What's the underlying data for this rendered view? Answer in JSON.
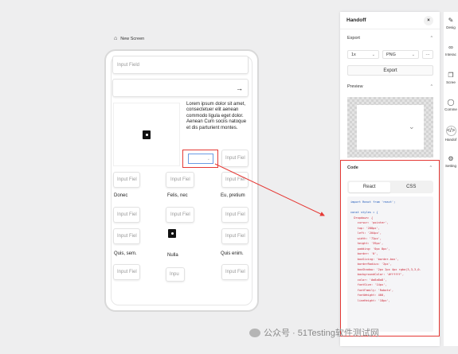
{
  "canvas": {
    "screen_title": "New Screen",
    "input_field_placeholder": "Input Field",
    "arrow_glyph": "→",
    "lorem_text": "Lorem ipsum dolor sit amet, consectetuer elit aenean commodo ligula eget dolor. Aenean Cum sociis natoque et dis parturient montes.",
    "dropdown_chevron": "⌄",
    "input_short": "Input Fiel",
    "labels": {
      "donec": "Donec",
      "felis": "Felis, nec",
      "eu": "Eu, pretium",
      "quis_sem": "Quis, sem.",
      "nulla": "Nulla",
      "quis_enim": "Quis enim.",
      "inpu": "Inpu"
    }
  },
  "panel": {
    "title": "Handoff",
    "close": "×",
    "export_label": "Export",
    "scale_value": "1x",
    "format_value": "PNG",
    "more": "···",
    "export_button": "Export",
    "preview_label": "Preview",
    "code_label": "Code",
    "tabs": [
      "React",
      "CSS"
    ],
    "code_lines": [
      "import React from 'react';",
      "",
      "const styles = {",
      "  Dropdown: {",
      "    cursor: 'pointer',",
      "    top: '288px',",
      "    left: '204px',",
      "    width: '72px',",
      "    height: '39px',",
      "    padding: '0px 8px',",
      "    border: '0',",
      "    boxSizing: 'border-box',",
      "    borderRadius: '2px',",
      "    boxShadow: '2px 2px 4px rgba(3,3,3,0.",
      "    backgroundColor: '#ffffff',",
      "    color: '#a8a8a8',",
      "    fontSize: '14px',",
      "    fontFamily: 'Roboto',",
      "    fontWeight: 400,",
      "    lineHeight: '18px',"
    ]
  },
  "strip": {
    "items": [
      {
        "label": "Desig",
        "icon": "pen-icon"
      },
      {
        "label": "Interac",
        "icon": "link-icon"
      },
      {
        "label": "Scree",
        "icon": "screens-icon"
      },
      {
        "label": "Comme",
        "icon": "comment-icon"
      },
      {
        "label": "Handof",
        "icon": "code-icon"
      },
      {
        "label": "Setting",
        "icon": "settings-icon"
      }
    ]
  },
  "watermark": "公众号 · 51Testing软件测试网",
  "colors": {
    "highlight": "#e53935",
    "focus_blue": "#6b9be4"
  }
}
